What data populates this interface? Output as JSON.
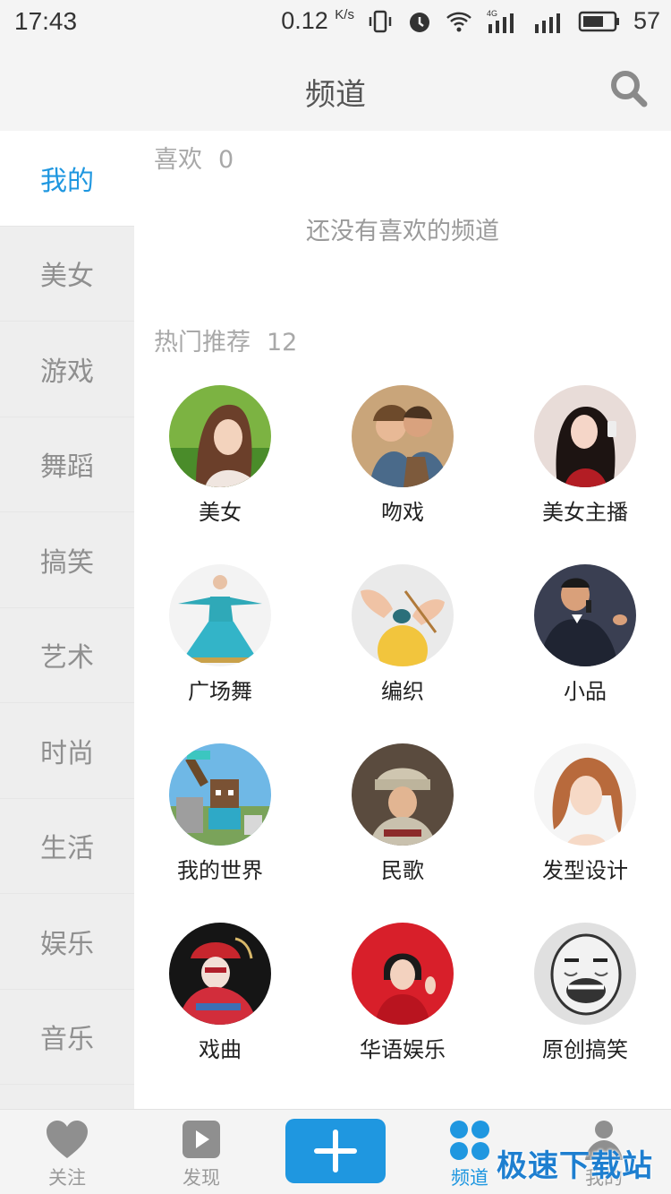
{
  "status_bar": {
    "time": "17:43",
    "speed": "0.12",
    "speed_unit": "K/s",
    "network": "4G",
    "battery": "57"
  },
  "header": {
    "title": "频道"
  },
  "sidebar": {
    "items": [
      {
        "label": "我的",
        "active": true
      },
      {
        "label": "美女"
      },
      {
        "label": "游戏"
      },
      {
        "label": "舞蹈"
      },
      {
        "label": "搞笑"
      },
      {
        "label": "艺术"
      },
      {
        "label": "时尚"
      },
      {
        "label": "生活"
      },
      {
        "label": "娱乐"
      },
      {
        "label": "音乐"
      }
    ]
  },
  "favorites": {
    "title": "喜欢",
    "count": "0",
    "empty_text": "还没有喜欢的频道"
  },
  "hot": {
    "title": "热门推荐",
    "count": "12",
    "channels": [
      {
        "label": "美女"
      },
      {
        "label": "吻戏"
      },
      {
        "label": "美女主播"
      },
      {
        "label": "广场舞"
      },
      {
        "label": "编织"
      },
      {
        "label": "小品"
      },
      {
        "label": "我的世界"
      },
      {
        "label": "民歌"
      },
      {
        "label": "发型设计"
      },
      {
        "label": "戏曲"
      },
      {
        "label": "华语娱乐"
      },
      {
        "label": "原创搞笑"
      }
    ]
  },
  "bottom_nav": {
    "items": [
      {
        "label": "关注",
        "icon": "heart-icon"
      },
      {
        "label": "发现",
        "icon": "play-icon"
      },
      {
        "label": "",
        "icon": "plus-icon"
      },
      {
        "label": "频道",
        "icon": "channel-grid-icon",
        "active": true
      },
      {
        "label": "我的",
        "icon": "person-icon"
      }
    ]
  },
  "watermark": "极速下载站",
  "colors": {
    "accent": "#1f97e0",
    "sidebar_bg": "#eeeeee",
    "text_gray": "#9a9a9a"
  }
}
